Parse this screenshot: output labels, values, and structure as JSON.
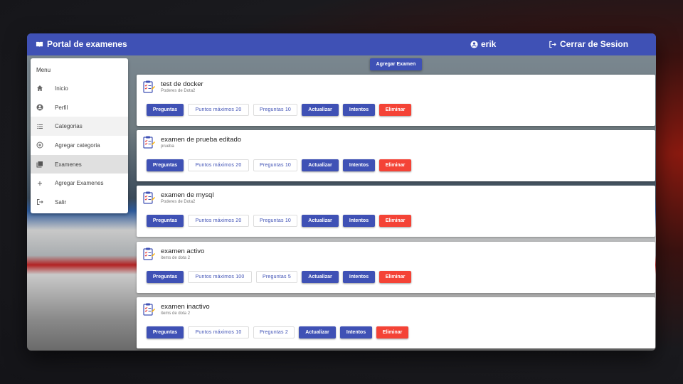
{
  "header": {
    "title": "Portal de examenes",
    "user": "erik",
    "logout": "Cerrar de Sesion"
  },
  "sidebar": {
    "title": "Menu",
    "items": [
      {
        "label": "Inicio",
        "icon": "home-icon"
      },
      {
        "label": "Perfil",
        "icon": "account-icon"
      },
      {
        "label": "Categorias",
        "icon": "list-icon"
      },
      {
        "label": "Agregar categoria",
        "icon": "add-circle-icon"
      },
      {
        "label": "Examenes",
        "icon": "library-icon"
      },
      {
        "label": "Agregar Examenes",
        "icon": "plus-icon"
      },
      {
        "label": "Salir",
        "icon": "exit-icon"
      }
    ]
  },
  "main": {
    "add_exam_label": "Agregar Examen",
    "exams": [
      {
        "title": "test de docker",
        "subtitle": "Poderes de Dota2",
        "questions_btn": "Preguntas",
        "max_points": "Puntos máximos 20",
        "num_questions": "Preguntas 10",
        "update": "Actualizar",
        "attempts": "Intentos",
        "delete": "Eliminar"
      },
      {
        "title": "examen de prueba editado",
        "subtitle": "prueba",
        "questions_btn": "Preguntas",
        "max_points": "Puntos máximos 20",
        "num_questions": "Preguntas 10",
        "update": "Actualizar",
        "attempts": "Intentos",
        "delete": "Eliminar"
      },
      {
        "title": "examen de mysql",
        "subtitle": "Poderes de Dota2",
        "questions_btn": "Preguntas",
        "max_points": "Puntos máximos 20",
        "num_questions": "Preguntas 10",
        "update": "Actualizar",
        "attempts": "Intentos",
        "delete": "Eliminar"
      },
      {
        "title": "examen activo",
        "subtitle": "items de dota 2",
        "questions_btn": "Preguntas",
        "max_points": "Puntos máximos 100",
        "num_questions": "Preguntas 5",
        "update": "Actualizar",
        "attempts": "Intentos",
        "delete": "Eliminar"
      },
      {
        "title": "examen inactivo",
        "subtitle": "items de dota 2",
        "questions_btn": "Preguntas",
        "max_points": "Puntos máximos 10",
        "num_questions": "Preguntas 2",
        "update": "Actualizar",
        "attempts": "Intentos",
        "delete": "Eliminar"
      }
    ]
  },
  "colors": {
    "primary": "#3f51b5",
    "danger": "#f44336"
  }
}
